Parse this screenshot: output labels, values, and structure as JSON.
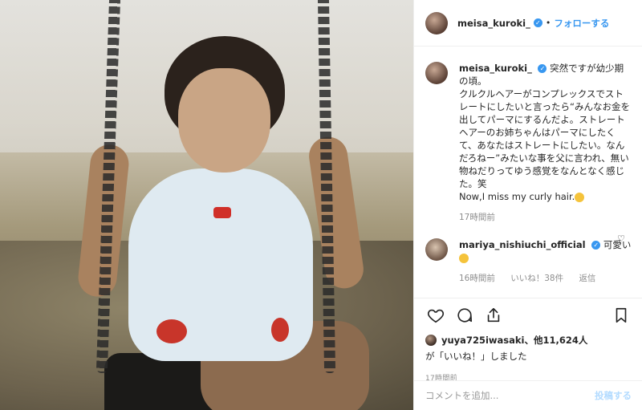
{
  "header": {
    "username": "meisa_kuroki_",
    "follow_label": "フォローする",
    "separator": "•"
  },
  "caption": {
    "username": "meisa_kuroki_",
    "lines": [
      "突然ですが幼少期の頃。",
      "クルクルヘアーがコンプレックスでストレートにしたいと言ったら“みんなお金を出してパーマにするんだよ。ストレートヘアーのお姉ちゃんはパーマにしたくて、あなたはストレートにしたい。なんだろねー”みたいな事を父に言われ、無い物ねだりってゆう感覚をなんとなく感じた。笑",
      "Now,I miss my curly hair."
    ],
    "time": "17時間前"
  },
  "reply": {
    "username": "mariya_nishiuchi_official",
    "text": "可愛い",
    "time": "16時間前",
    "likes": "いいね！38件",
    "reply_label": "返信"
  },
  "likes": {
    "user": "yuya725iwasaki",
    "others": "、他11,624人",
    "suffix": "が「いいね！」しました"
  },
  "post_time": "17時間前",
  "comment_box": {
    "placeholder": "コメントを追加...",
    "post_label": "投稿する"
  },
  "icons": {
    "verified": "✓"
  },
  "colors": {
    "accent": "#3897f0",
    "muted": "#8e8e8e",
    "post_disabled": "#b3dbff"
  }
}
